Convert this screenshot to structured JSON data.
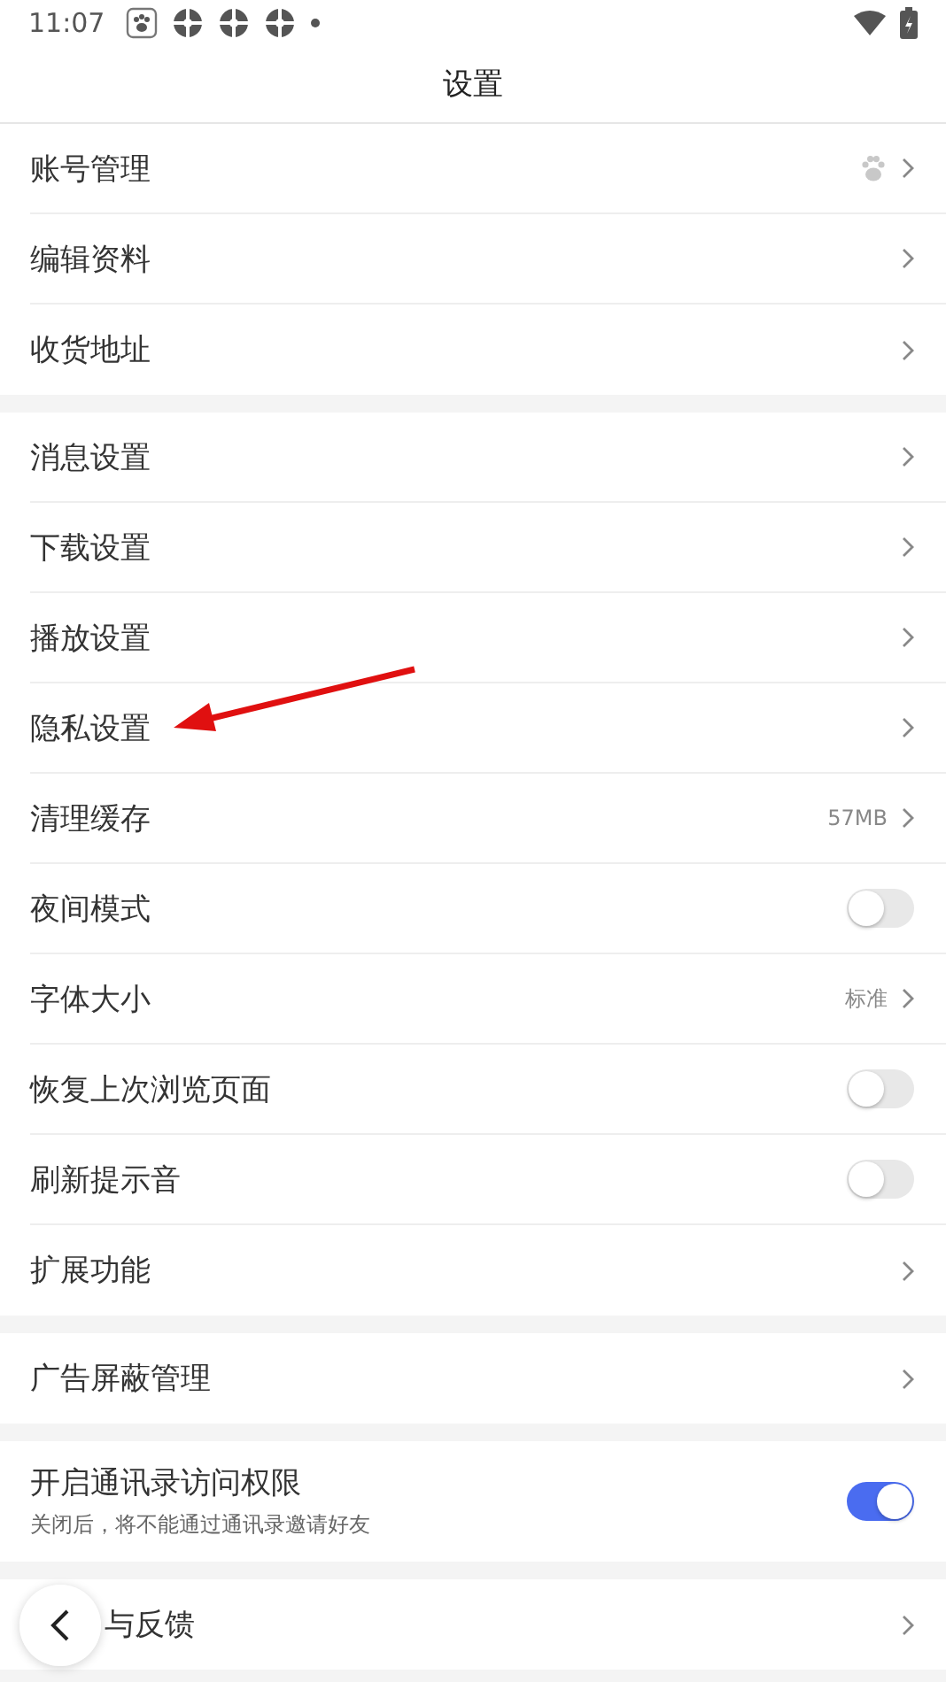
{
  "status_bar": {
    "time": "11:07"
  },
  "header": {
    "title": "设置"
  },
  "sections": [
    {
      "rows": [
        {
          "kind": "link",
          "label": "账号管理",
          "paw_icon": true
        },
        {
          "kind": "link",
          "label": "编辑资料"
        },
        {
          "kind": "link",
          "label": "收货地址"
        }
      ]
    },
    {
      "rows": [
        {
          "kind": "link",
          "label": "消息设置"
        },
        {
          "kind": "link",
          "label": "下载设置"
        },
        {
          "kind": "link",
          "label": "播放设置"
        },
        {
          "kind": "link",
          "label": "隐私设置"
        },
        {
          "kind": "link",
          "label": "清理缓存",
          "value": "57MB"
        },
        {
          "kind": "toggle",
          "label": "夜间模式",
          "on": false
        },
        {
          "kind": "link",
          "label": "字体大小",
          "value": "标准"
        },
        {
          "kind": "toggle",
          "label": "恢复上次浏览页面",
          "on": false
        },
        {
          "kind": "toggle",
          "label": "刷新提示音",
          "on": false
        },
        {
          "kind": "link",
          "label": "扩展功能"
        }
      ]
    },
    {
      "rows": [
        {
          "kind": "link",
          "label": "广告屏蔽管理"
        }
      ]
    },
    {
      "rows": [
        {
          "kind": "toggle",
          "label": "开启通讯录访问权限",
          "hint": "关闭后，将不能通过通讯录邀请好友",
          "on": true
        }
      ]
    },
    {
      "rows": [
        {
          "kind": "link",
          "label": "与反馈",
          "back_button": true
        }
      ]
    }
  ]
}
